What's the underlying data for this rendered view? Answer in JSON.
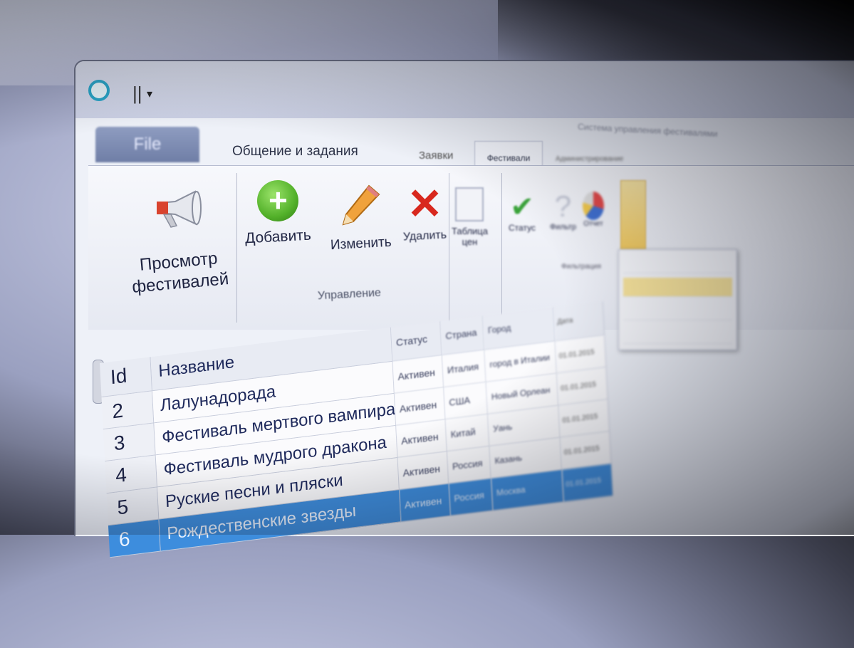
{
  "quick_access": {
    "separator": "||",
    "dropdown_icon": "▾"
  },
  "window_title": "Система управления фестивалями",
  "tabs": [
    {
      "label": "File"
    },
    {
      "label": "Общение и задания"
    },
    {
      "label": "Заявки"
    },
    {
      "label": "Фестивали"
    },
    {
      "label": "Администрирование"
    }
  ],
  "ribbon": {
    "view_button": {
      "label_line1": "Просмотр",
      "label_line2": "фестивалей",
      "icon": "megaphone-icon"
    },
    "add_button": {
      "label": "Добавить",
      "icon": "plus-icon"
    },
    "edit_button": {
      "label": "Изменить",
      "icon": "pencil-icon"
    },
    "delete_button": {
      "label": "Удалить",
      "icon": "cross-icon"
    },
    "prices_button": {
      "label_line1": "Таблица",
      "label_line2": "цен",
      "icon": "table-icon"
    },
    "status_button": {
      "label": "Статус",
      "icon": "checkmark-icon"
    },
    "help_button": {
      "label": "Фильтр",
      "icon": "question-icon"
    },
    "data_button": {
      "label": "Отчет",
      "icon": "chart-icon"
    },
    "group_manage_label": "Управление",
    "group_view_label": "Фильтрация"
  },
  "grid": {
    "columns": {
      "id": "Id",
      "name": "Название",
      "status": "Статус",
      "country": "Страна",
      "city": "Город",
      "date": "Дата"
    },
    "rows": [
      {
        "id": "2",
        "name": "Лалунадорада",
        "status": "Активен",
        "country": "Италия",
        "city": "город в Италии",
        "date": "01.01.2015"
      },
      {
        "id": "3",
        "name": "Фестиваль мертвого вампира",
        "status": "Активен",
        "country": "США",
        "city": "Новый Орлеан",
        "date": "01.01.2015"
      },
      {
        "id": "4",
        "name": "Фестиваль мудрого дракона",
        "status": "Активен",
        "country": "Китай",
        "city": "Уань",
        "date": "01.01.2015"
      },
      {
        "id": "5",
        "name": "Руские песни и пляски",
        "status": "Активен",
        "country": "Россия",
        "city": "Казань",
        "date": "01.01.2015"
      },
      {
        "id": "6",
        "name": "Рождественские звезды",
        "status": "Активен",
        "country": "Россия",
        "city": "Москва",
        "date": "01.01.2015",
        "selected": true
      }
    ]
  },
  "colors": {
    "selection": "#3d8ddd",
    "accent_add": "#53b12a",
    "accent_delete": "#d8281e",
    "highlight": "#f0c960"
  }
}
